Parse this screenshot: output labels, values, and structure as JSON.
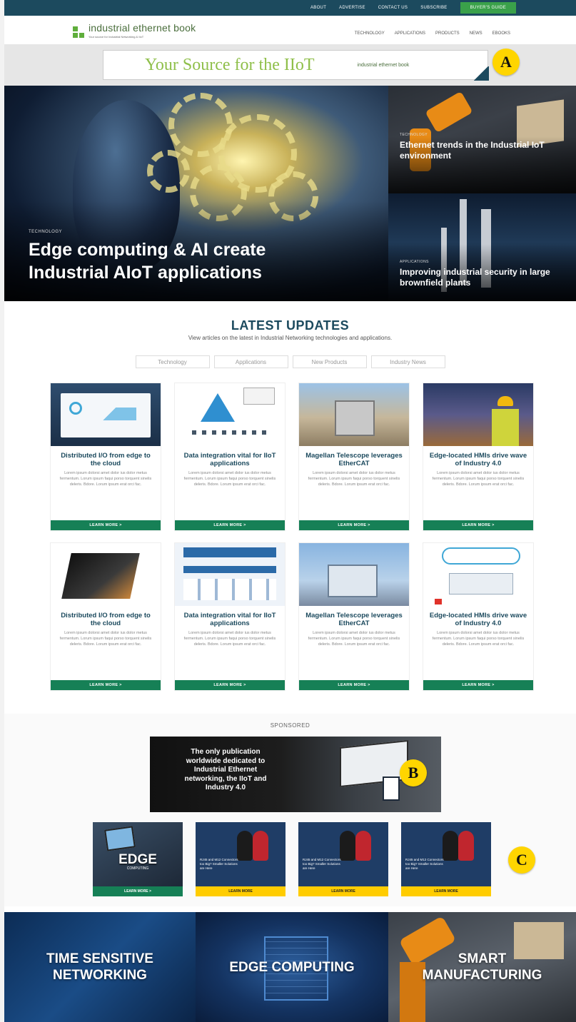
{
  "topbar": {
    "links": [
      "ABOUT",
      "ADVERTISE",
      "CONTACT US",
      "SUBSCRIBE"
    ],
    "guide": "BUYER'S GUIDE"
  },
  "header": {
    "logo": "industrial ethernet book",
    "tagline": "Your source for Industrial Networking & IIoT",
    "nav": [
      "TECHNOLOGY",
      "APPLICATIONS",
      "PRODUCTS",
      "NEWS",
      "EBOOKS"
    ]
  },
  "ad": {
    "tagline": "Your Source for the IIoT",
    "logo": "industrial ethernet book"
  },
  "badges": {
    "a": "A",
    "b": "B",
    "c": "C"
  },
  "hero": {
    "main": {
      "category": "TECHNOLOGY",
      "title": "Edge computing & AI create Industrial AIoT applications"
    },
    "side": [
      {
        "category": "TECHNOLOGY",
        "title": "Ethernet trends in the Industrial IoT environment"
      },
      {
        "category": "APPLICATIONS",
        "title": "Improving industrial security in large brownfield plants"
      }
    ]
  },
  "latest": {
    "heading": "LATEST UPDATES",
    "subtitle": "View articles on the latest in Industrial Networking technologies and applications.",
    "filters": [
      "Technology",
      "Applications",
      "New Products",
      "Industry News"
    ]
  },
  "cards": [
    {
      "title": "Distributed I/O from edge to the cloud",
      "body": "Lorem ipsum dolorsi amet dolor ius dolor metus fermentum. Lorum ipsum faqui porso torquent sinelis deleris. Bdore. Lorum ipsum erat orci fac.",
      "button": "LEARN MORE >"
    },
    {
      "title": "Data integration vital for IIoT applications",
      "body": "Lorem ipsum dolorsi amet dolor ius dolor metus fermentum. Lorum ipsum faqui porso torquent sinelis deleris. Bdore. Lorum ipsum erat orci fac.",
      "button": "LEARN MORE >"
    },
    {
      "title": "Magellan Telescope leverages EtherCAT",
      "body": "Lorem ipsum dolorsi amet dolor ius dolor metus fermentum. Lorum ipsum faqui porso torquent sinelis deleris. Bdore. Lorum ipsum erat orci fac.",
      "button": "LEARN MORE >"
    },
    {
      "title": "Edge-located HMIs drive wave of Industry 4.0",
      "body": "Lorem ipsum dolorsi amet dolor ius dolor metus fermentum. Lorum ipsum faqui porso torquent sinelis deleris. Bdore. Lorum ipsum erat orci fac.",
      "button": "LEARN MORE >"
    },
    {
      "title": "Distributed I/O from edge to the cloud",
      "body": "Lorem ipsum dolorsi amet dolor ius dolor metus fermentum. Lorum ipsum faqui porso torquent sinelis deleris. Bdore. Lorum ipsum erat orci fac.",
      "button": "LEARN MORE >"
    },
    {
      "title": "Data integration vital for IIoT applications",
      "body": "Lorem ipsum dolorsi amet dolor ius dolor metus fermentum. Lorum ipsum faqui porso torquent sinelis deleris. Bdore. Lorum ipsum erat orci fac.",
      "button": "LEARN MORE >"
    },
    {
      "title": "Magellan Telescope leverages EtherCAT",
      "body": "Lorem ipsum dolorsi amet dolor ius dolor metus fermentum. Lorum ipsum faqui porso torquent sinelis deleris. Bdore. Lorum ipsum erat orci fac.",
      "button": "LEARN MORE >"
    },
    {
      "title": "Edge-located HMIs drive wave of Industry 4.0",
      "body": "Lorem ipsum dolorsi amet dolor ius dolor metus fermentum. Lorum ipsum faqui porso torquent sinelis deleris. Bdore. Lorum ipsum erat orci fac.",
      "button": "LEARN MORE >"
    }
  ],
  "sponsored": {
    "label": "SPONSORED",
    "banner_text": "The only publication worldwide dedicated to Industrial Ethernet networking, the IIoT and Industry 4.0",
    "minis": [
      {
        "big": "EDGE",
        "small": "COMPUTING",
        "button": "LEARN MORE >"
      },
      {
        "caption": "RJ45 and M12 Connectors too Big? Smaller Solutions are Here",
        "button": "LEARN MORE"
      },
      {
        "caption": "RJ45 and M12 Connectors too Big? Smaller Solutions are Here",
        "button": "LEARN MORE"
      },
      {
        "caption": "RJ45 and M12 Connectors too Big? Smaller Solutions are Here",
        "button": "LEARN MORE"
      }
    ]
  },
  "bottom": [
    {
      "line1": "TIME SENSITIVE",
      "line2": "NETWORKING"
    },
    {
      "line1": "EDGE COMPUTING",
      "line2": ""
    },
    {
      "line1": "SMART",
      "line2": "MANUFACTURING"
    }
  ],
  "colors": {
    "brand_dark": "#1c4a5e",
    "brand_green": "#168056",
    "badge_yellow": "#ffd500",
    "accent_yellow": "#ffcc00"
  }
}
